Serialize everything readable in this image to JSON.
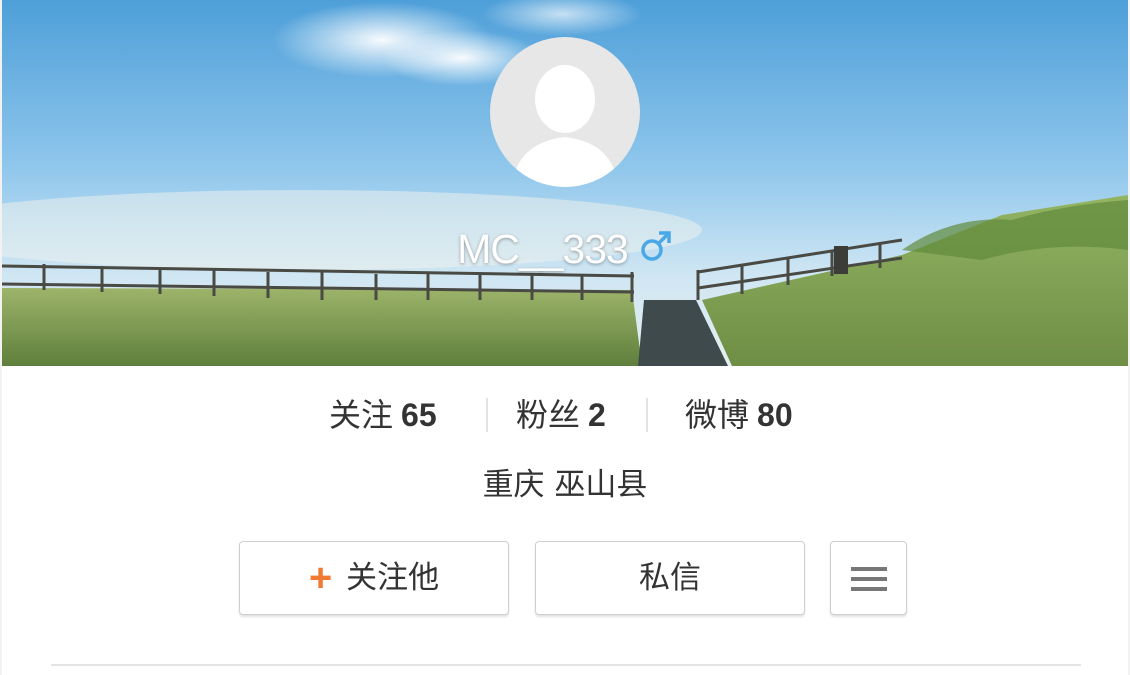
{
  "profile": {
    "username": "MC__333",
    "gender_icon": "male-icon",
    "location": "重庆 巫山县",
    "avatar_icon": "default-avatar-icon"
  },
  "stats": [
    {
      "label": "关注",
      "value": "65"
    },
    {
      "label": "粉丝",
      "value": "2"
    },
    {
      "label": "微博",
      "value": "80"
    }
  ],
  "actions": {
    "follow_plus": "+",
    "follow_label": "关注他",
    "message_label": "私信",
    "more_icon": "menu-icon"
  },
  "colors": {
    "accent_orange": "#f07a32",
    "gender_blue": "#4aa7e8",
    "text_dark": "#333333"
  }
}
